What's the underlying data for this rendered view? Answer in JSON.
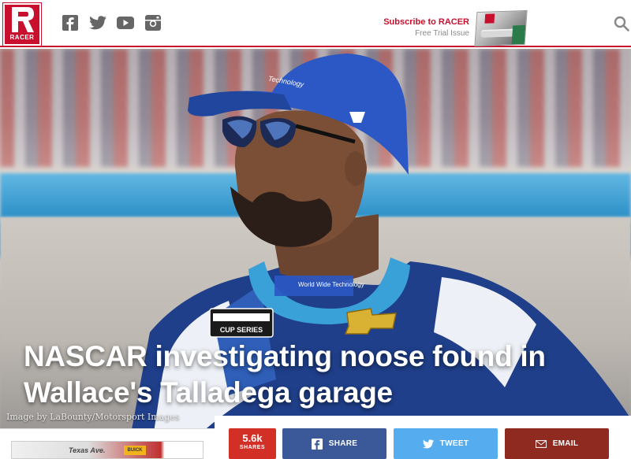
{
  "header": {
    "logo_text": "RACER",
    "social_icons": [
      "facebook-icon",
      "twitter-icon",
      "youtube-icon",
      "instagram-icon"
    ],
    "subscribe_title": "Subscribe to RACER",
    "subscribe_subtitle": "Free Trial Issue",
    "search_icon": "search-icon"
  },
  "hero": {
    "headline": "NASCAR investigating noose found in Wallace's Talladega garage",
    "image_credit": "Image by LaBounty/Motorsport Images",
    "suit_text_1": "World Wide Technology",
    "suit_text_2": "CUP SERIES",
    "cap_text": "Technology"
  },
  "share_bar": {
    "share_count": "5.6k",
    "share_count_label": "SHARES",
    "facebook_label": "SHARE",
    "twitter_label": "TWEET",
    "email_label": "EMAIL"
  },
  "ad": {
    "text": "Texas Ave.",
    "badge": "BUICK"
  },
  "colors": {
    "brand_red": "#c8102e",
    "facebook_blue": "#3b5998",
    "twitter_blue": "#55acee",
    "email_red": "#8e2a20",
    "shares_red": "#d22f27"
  }
}
